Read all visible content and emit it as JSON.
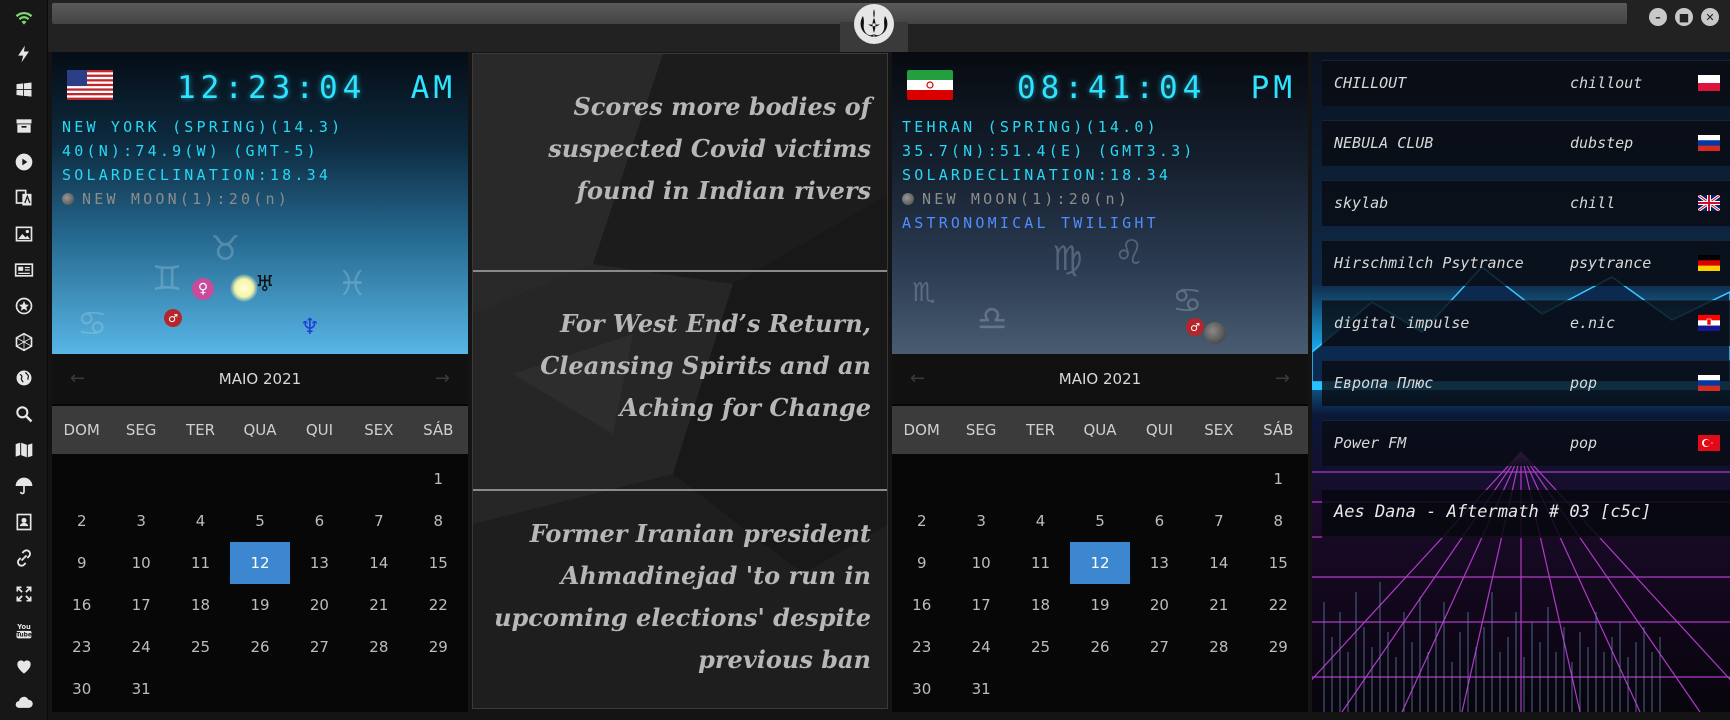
{
  "sidebar": {
    "icons": [
      "wifi-icon",
      "bolt-icon",
      "windows-icon",
      "archive-icon",
      "play-icon",
      "translate-icon",
      "image-icon",
      "newspaper-icon",
      "settings-star-icon",
      "hexagon-icon",
      "globe-icon",
      "search-icon",
      "map-icon",
      "umbrella-icon",
      "contact-icon",
      "link-icon",
      "expand-icon",
      "youtube-icon",
      "heart-icon",
      "cloud-icon"
    ]
  },
  "clocks": [
    {
      "flag": "us",
      "time": "12:23:04",
      "ampm": "AM",
      "line1": "NEW YORK (SPRING)(14.3)",
      "line2": "40(N):74.9(W) (GMT-5)",
      "line3": "SOLARDECLINATION:18.34",
      "moon": "NEW MOON(1):20(n)"
    },
    {
      "flag": "iran",
      "time": "08:41:04",
      "ampm": "PM",
      "line1": "TEHRAN (SPRING)(14.0)",
      "line2": "35.7(N):51.4(E) (GMT3.3)",
      "line3": "SOLARDECLINATION:18.34",
      "moon": "NEW MOON(1):20(n)",
      "twilight": "ASTRONOMICAL TWILIGHT"
    }
  ],
  "calendar": {
    "month": "MAIO 2021",
    "weekdays": [
      "DOM",
      "SEG",
      "TER",
      "QUA",
      "QUI",
      "SEX",
      "SÁB"
    ],
    "first_weekday_index": 6,
    "days_in_month": 31,
    "selected_day": 12,
    "prev_arrow": "←",
    "next_arrow": "→"
  },
  "news": [
    "Scores more bodies of suspected Covid victims found in Indian rivers",
    "For West End’s Return, Cleansing Spirits and an Aching for Change",
    "Former Iranian president Ahmadinejad 'to run in upcoming elections' despite previous ban"
  ],
  "radio": {
    "stations": [
      {
        "name": "CHILLOUT",
        "genre": "chillout",
        "flag": "poland"
      },
      {
        "name": "NEBULA CLUB",
        "genre": "dubstep",
        "flag": "russia"
      },
      {
        "name": "skylab",
        "genre": "chill",
        "flag": "uk"
      },
      {
        "name": "Hirschmilch Psytrance",
        "genre": "psytrance",
        "flag": "germany"
      },
      {
        "name": "digital impulse",
        "genre": "e.nic",
        "flag": "croatia"
      },
      {
        "name": "Европа Плюс",
        "genre": "pop",
        "flag": "russia"
      },
      {
        "name": "Power FM",
        "genre": "pop",
        "flag": "turkey"
      }
    ],
    "now_playing": "Aes Dana - Aftermath # 03 [c5c]"
  },
  "colors": {
    "accent_cyan": "#2ee3ff",
    "twilight_blue": "#4f8dff",
    "selected_day": "#3d87d1"
  }
}
